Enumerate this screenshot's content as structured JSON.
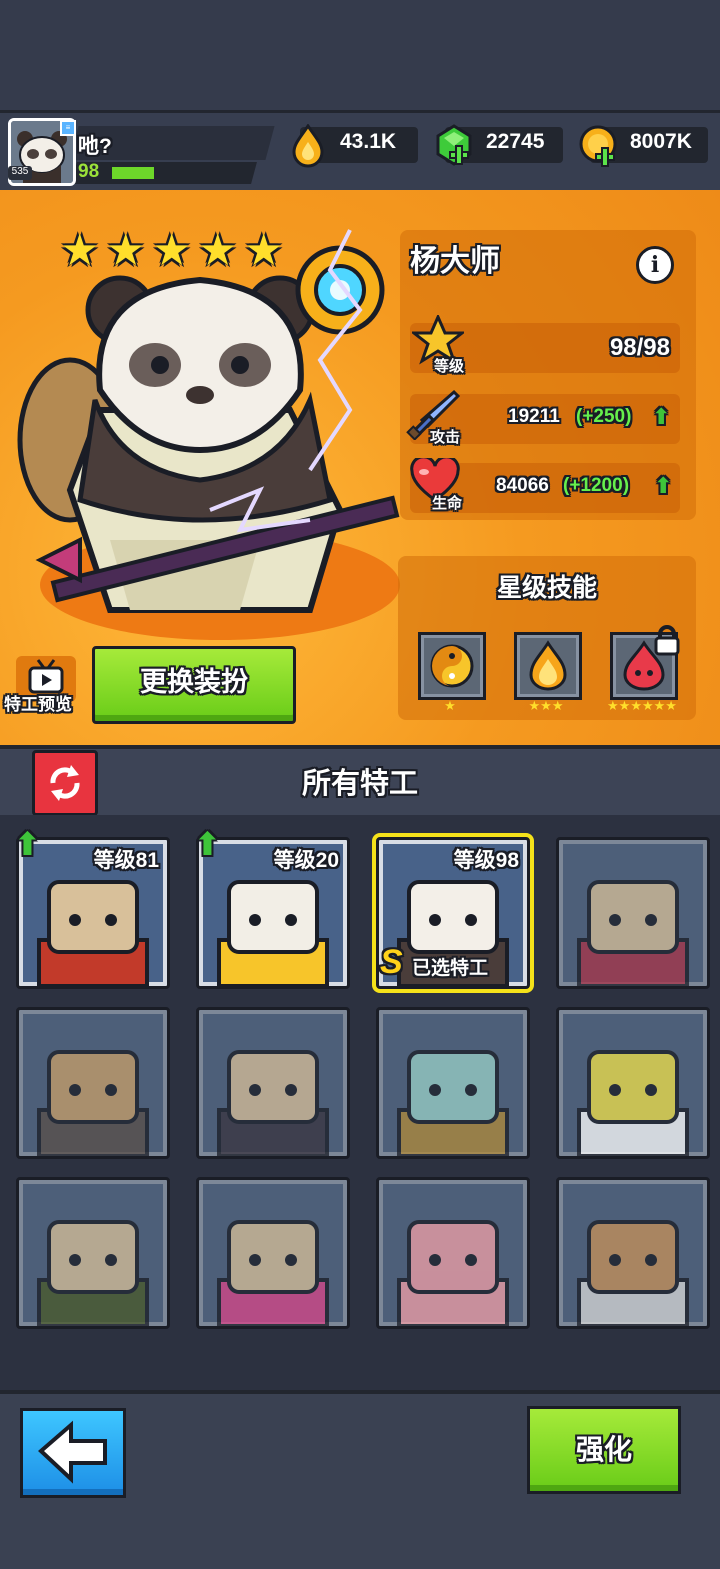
{
  "player": {
    "name": "吔?",
    "level": "98",
    "avatar_badge": "535",
    "xp_fraction": 0.3
  },
  "resources": [
    {
      "icon": "flame-drop-icon",
      "value": "43.1K"
    },
    {
      "icon": "green-gem-plus-icon",
      "value": "22745"
    },
    {
      "icon": "gold-coin-plus-icon",
      "value": "8007K"
    }
  ],
  "hero": {
    "name": "杨大师",
    "star_count": 5,
    "stats": {
      "level_label": "等级",
      "level_value": "98/98",
      "attack_label": "攻击",
      "attack_value": "19211",
      "attack_bonus": "(+250)",
      "hp_label": "生命",
      "hp_value": "84066",
      "hp_bonus": "(+1200)"
    },
    "skills_title": "星级技能",
    "skills": [
      {
        "icon": "yin-yang-icon",
        "stars": "★",
        "locked": false
      },
      {
        "icon": "fire-spirit-icon",
        "stars": "★★★",
        "locked": false
      },
      {
        "icon": "red-flame-icon",
        "stars": "★★★★★★",
        "locked": true
      }
    ],
    "preview_label": "特工预览",
    "change_skin_label": "更换装扮"
  },
  "list": {
    "title": "所有特工",
    "agents": [
      {
        "level": "等级81",
        "upgradable": true,
        "char": "goggle-ninja",
        "locked": false
      },
      {
        "level": "等级20",
        "upgradable": true,
        "char": "cat",
        "locked": false
      },
      {
        "level": "等级98",
        "upgradable": false,
        "char": "panda",
        "locked": false,
        "selected": true,
        "selected_label": "已选特工",
        "rank": "S"
      },
      {
        "level": "",
        "upgradable": false,
        "char": "red-hair",
        "locked": true
      },
      {
        "level": "",
        "upgradable": false,
        "char": "gasmask",
        "locked": true
      },
      {
        "level": "",
        "upgradable": false,
        "char": "ginger",
        "locked": true
      },
      {
        "level": "",
        "upgradable": false,
        "char": "squidward",
        "locked": true
      },
      {
        "level": "",
        "upgradable": false,
        "char": "spongebob",
        "locked": true
      },
      {
        "level": "",
        "upgradable": false,
        "char": "soldier",
        "locked": true
      },
      {
        "level": "",
        "upgradable": false,
        "char": "pink-hair",
        "locked": true
      },
      {
        "level": "",
        "upgradable": false,
        "char": "patrick",
        "locked": true
      },
      {
        "level": "",
        "upgradable": false,
        "char": "sandy",
        "locked": true
      }
    ]
  },
  "bottom": {
    "upgrade_label": "强化"
  },
  "colors": {
    "accent_green": "#6dd72a",
    "hero_bg": "#f29a1c",
    "selected_outline": "#f5e21a"
  }
}
